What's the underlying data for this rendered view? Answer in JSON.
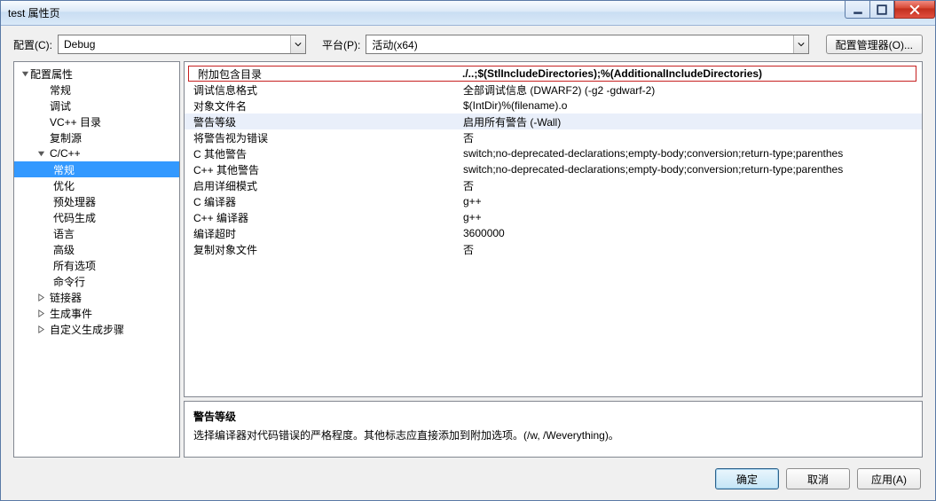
{
  "window": {
    "title": "test 属性页"
  },
  "toolbar": {
    "config_label": "配置(C):",
    "config_value": "Debug",
    "platform_label": "平台(P):",
    "platform_value": "活动(x64)",
    "config_manager_label": "配置管理器(O)..."
  },
  "tree": {
    "root_label": "配置属性",
    "items1": [
      "常规",
      "调试",
      "VC++ 目录",
      "复制源"
    ],
    "cc_label": "C/C++",
    "cc_items": [
      "常规",
      "优化",
      "预处理器",
      "代码生成",
      "语言",
      "高级",
      "所有选项",
      "命令行"
    ],
    "after": [
      "链接器",
      "生成事件",
      "自定义生成步骤"
    ]
  },
  "grid": {
    "rows": [
      {
        "k": "附加包含目录",
        "v": "./..;$(StlIncludeDirectories);%(AdditionalIncludeDirectories)"
      },
      {
        "k": "调试信息格式",
        "v": "全部调试信息 (DWARF2) (-g2 -gdwarf-2)"
      },
      {
        "k": "对象文件名",
        "v": "$(IntDir)%(filename).o"
      },
      {
        "k": "警告等级",
        "v": "启用所有警告 (-Wall)"
      },
      {
        "k": "将警告视为错误",
        "v": "否"
      },
      {
        "k": "C 其他警告",
        "v": "switch;no-deprecated-declarations;empty-body;conversion;return-type;parenthes"
      },
      {
        "k": "C++ 其他警告",
        "v": "switch;no-deprecated-declarations;empty-body;conversion;return-type;parenthes"
      },
      {
        "k": "启用详细模式",
        "v": "否"
      },
      {
        "k": "C 编译器",
        "v": "g++"
      },
      {
        "k": "C++ 编译器",
        "v": "g++"
      },
      {
        "k": "编译超时",
        "v": "3600000"
      },
      {
        "k": "复制对象文件",
        "v": "否"
      }
    ]
  },
  "description": {
    "title": "警告等级",
    "text": "选择编译器对代码错误的严格程度。其他标志应直接添加到附加选项。(/w, /Weverything)。"
  },
  "buttons": {
    "ok": "确定",
    "cancel": "取消",
    "apply": "应用(A)"
  }
}
